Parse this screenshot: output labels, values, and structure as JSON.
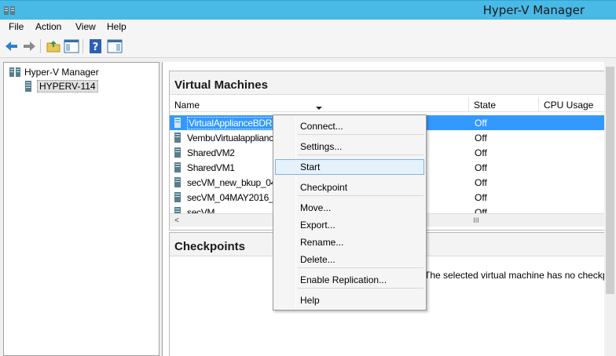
{
  "window": {
    "title": "Hyper-V Manager",
    "icon": "hyper-v-manager-icon"
  },
  "menubar": {
    "items": [
      "File",
      "Action",
      "View",
      "Help"
    ]
  },
  "toolbar": {
    "icons": [
      "back-arrow-icon",
      "forward-arrow-icon",
      "up-folder-icon",
      "show-hide-console-tree-icon",
      "help-icon",
      "show-hide-action-pane-icon"
    ]
  },
  "tree": {
    "root": "Hyper-V Manager",
    "server": "HYPERV-114"
  },
  "vm_panel": {
    "title": "Virtual Machines",
    "columns": [
      "Name",
      "State",
      "CPU Usage"
    ],
    "rows": [
      {
        "name": "VirtualApplianceBDR",
        "state": "Off",
        "selected": true
      },
      {
        "name": "VembuVirtualapplianceC",
        "state": "Off",
        "selected": false
      },
      {
        "name": "SharedVM2",
        "state": "Off",
        "selected": false
      },
      {
        "name": "SharedVM1",
        "state": "Off",
        "selected": false
      },
      {
        "name": "secVM_new_bkup_04_",
        "state": "Off",
        "selected": false
      },
      {
        "name": "secVM_04MAY2016_1",
        "state": "Off",
        "selected": false
      },
      {
        "name": "secVM",
        "state": "Off",
        "selected": false
      }
    ],
    "scroll_left": "<",
    "scroll_thumb": "III"
  },
  "checkpoints_panel": {
    "title": "Checkpoints",
    "message": "The selected virtual machine has no checkpoints"
  },
  "context_menu": {
    "items": [
      {
        "label": "Connect...",
        "hover": false
      },
      {
        "label": "Settings...",
        "hover": false
      },
      {
        "label": "Start",
        "hover": true
      },
      {
        "label": "Checkpoint",
        "hover": false
      },
      {
        "label": "Move...",
        "hover": false
      },
      {
        "label": "Export...",
        "hover": false
      },
      {
        "label": "Rename...",
        "hover": false
      },
      {
        "label": "Delete...",
        "hover": false
      },
      {
        "label": "Enable Replication...",
        "hover": false
      },
      {
        "label": "Help",
        "hover": false
      }
    ]
  },
  "colors": {
    "titlebar": "#49b9e6",
    "selection": "#3399ff",
    "menu_hover": "#e5f1fb"
  }
}
